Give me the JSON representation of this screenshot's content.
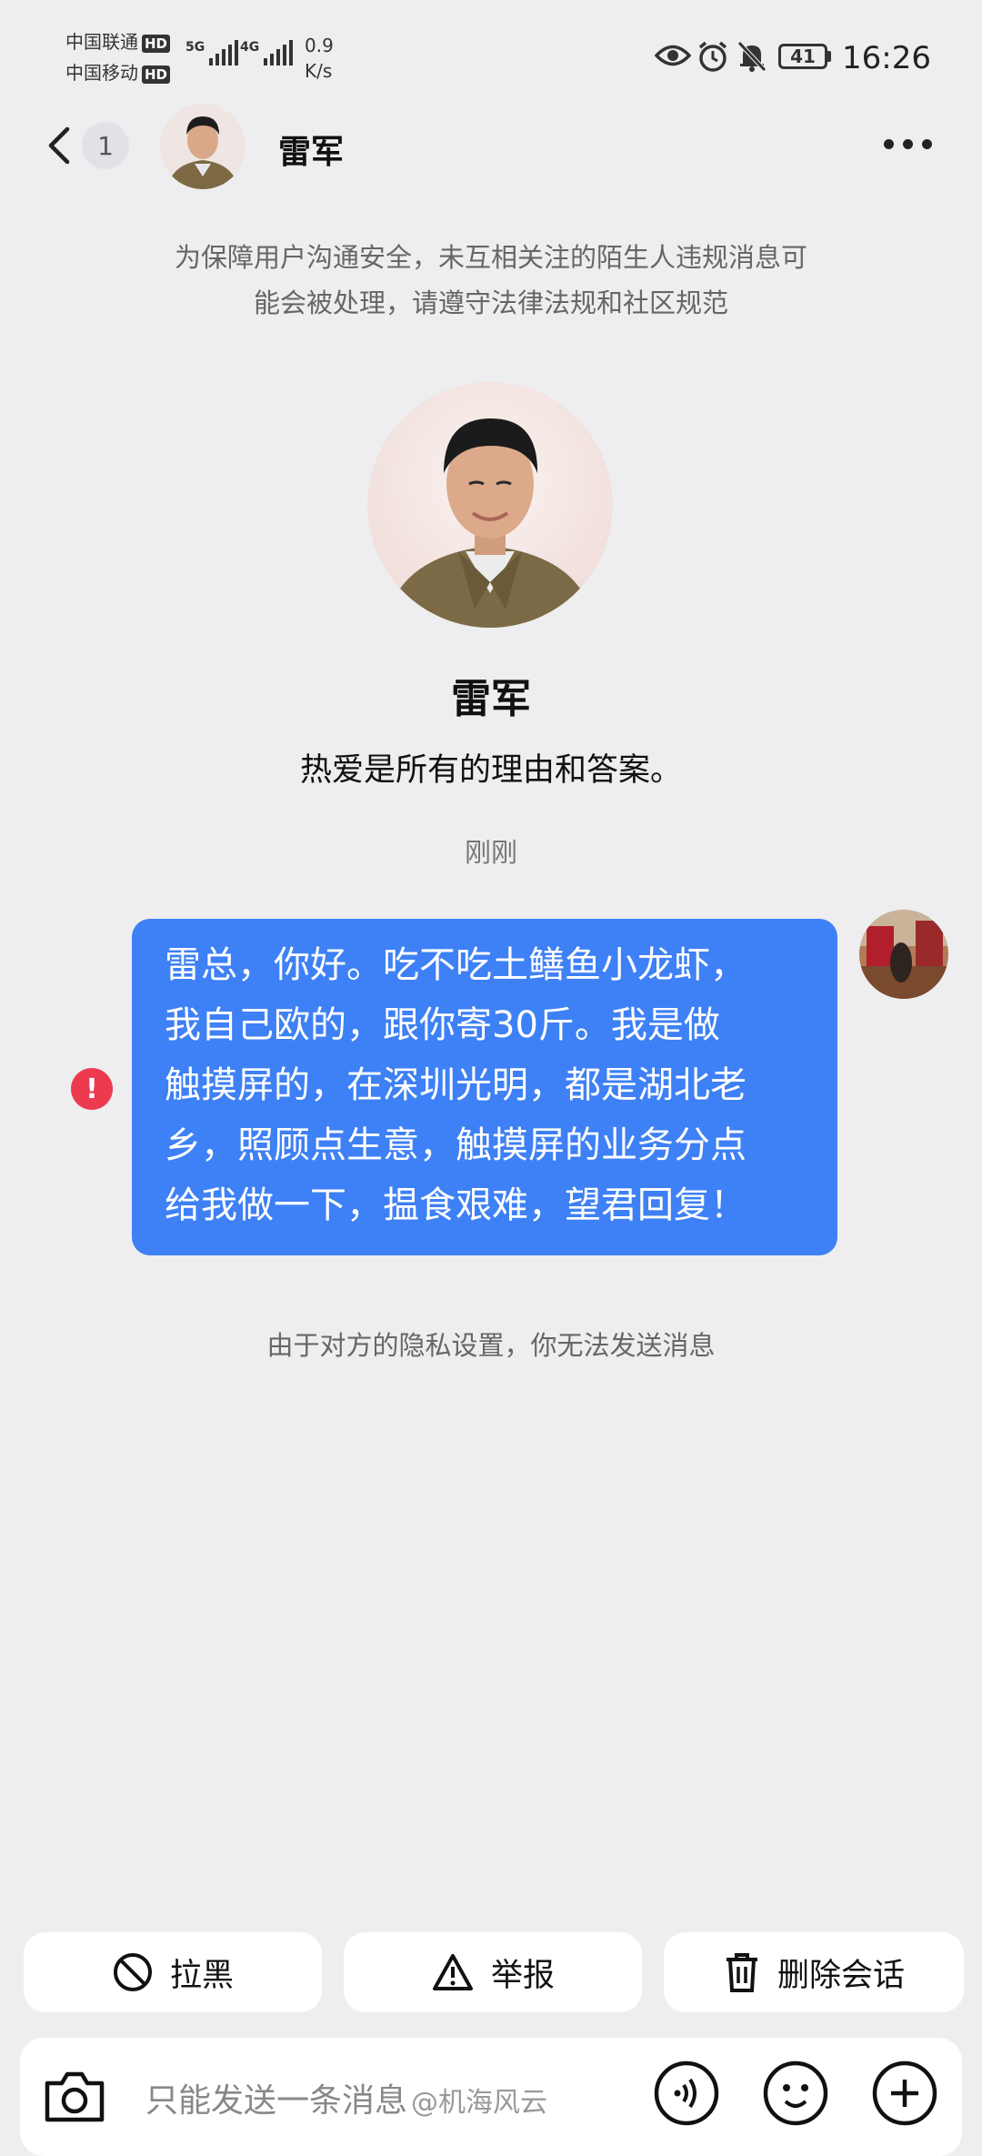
{
  "status_bar": {
    "carrier1": "中国联通",
    "carrier2": "中国移动",
    "hd": "HD",
    "net1": "5G",
    "net2": "4G",
    "speed_value": "0.9",
    "speed_unit": "K/s",
    "battery": "41",
    "time": "16:26"
  },
  "header": {
    "back_count": "1",
    "title": "雷军"
  },
  "safety_notice": {
    "line1": "为保障用户沟通安全，未互相关注的陌生人违规消息可",
    "line2": "能会被处理，请遵守法律法规和社区规范"
  },
  "profile": {
    "name": "雷军",
    "bio": "热爱是所有的理由和答案。"
  },
  "timestamp": "刚刚",
  "message": {
    "lines": [
      "雷总，你好。吃不吃土鳝鱼小龙虾，",
      "我自己欧的，跟你寄30斤。我是做",
      "触摸屏的，在深圳光明，都是湖北老",
      "乡，照顾点生意，触摸屏的业务分点",
      "给我做一下，揾食艰难，望君回复！"
    ],
    "error_mark": "!"
  },
  "privacy_notice": "由于对方的隐私设置，你无法发送消息",
  "actions": {
    "block": "拉黑",
    "report": "举报",
    "delete": "删除会话"
  },
  "input": {
    "placeholder": "只能发送一条消息"
  },
  "watermark": "@机海风云",
  "colors": {
    "bubble": "#3e80f5",
    "error": "#ec3a4f",
    "background": "#eeeef0"
  }
}
